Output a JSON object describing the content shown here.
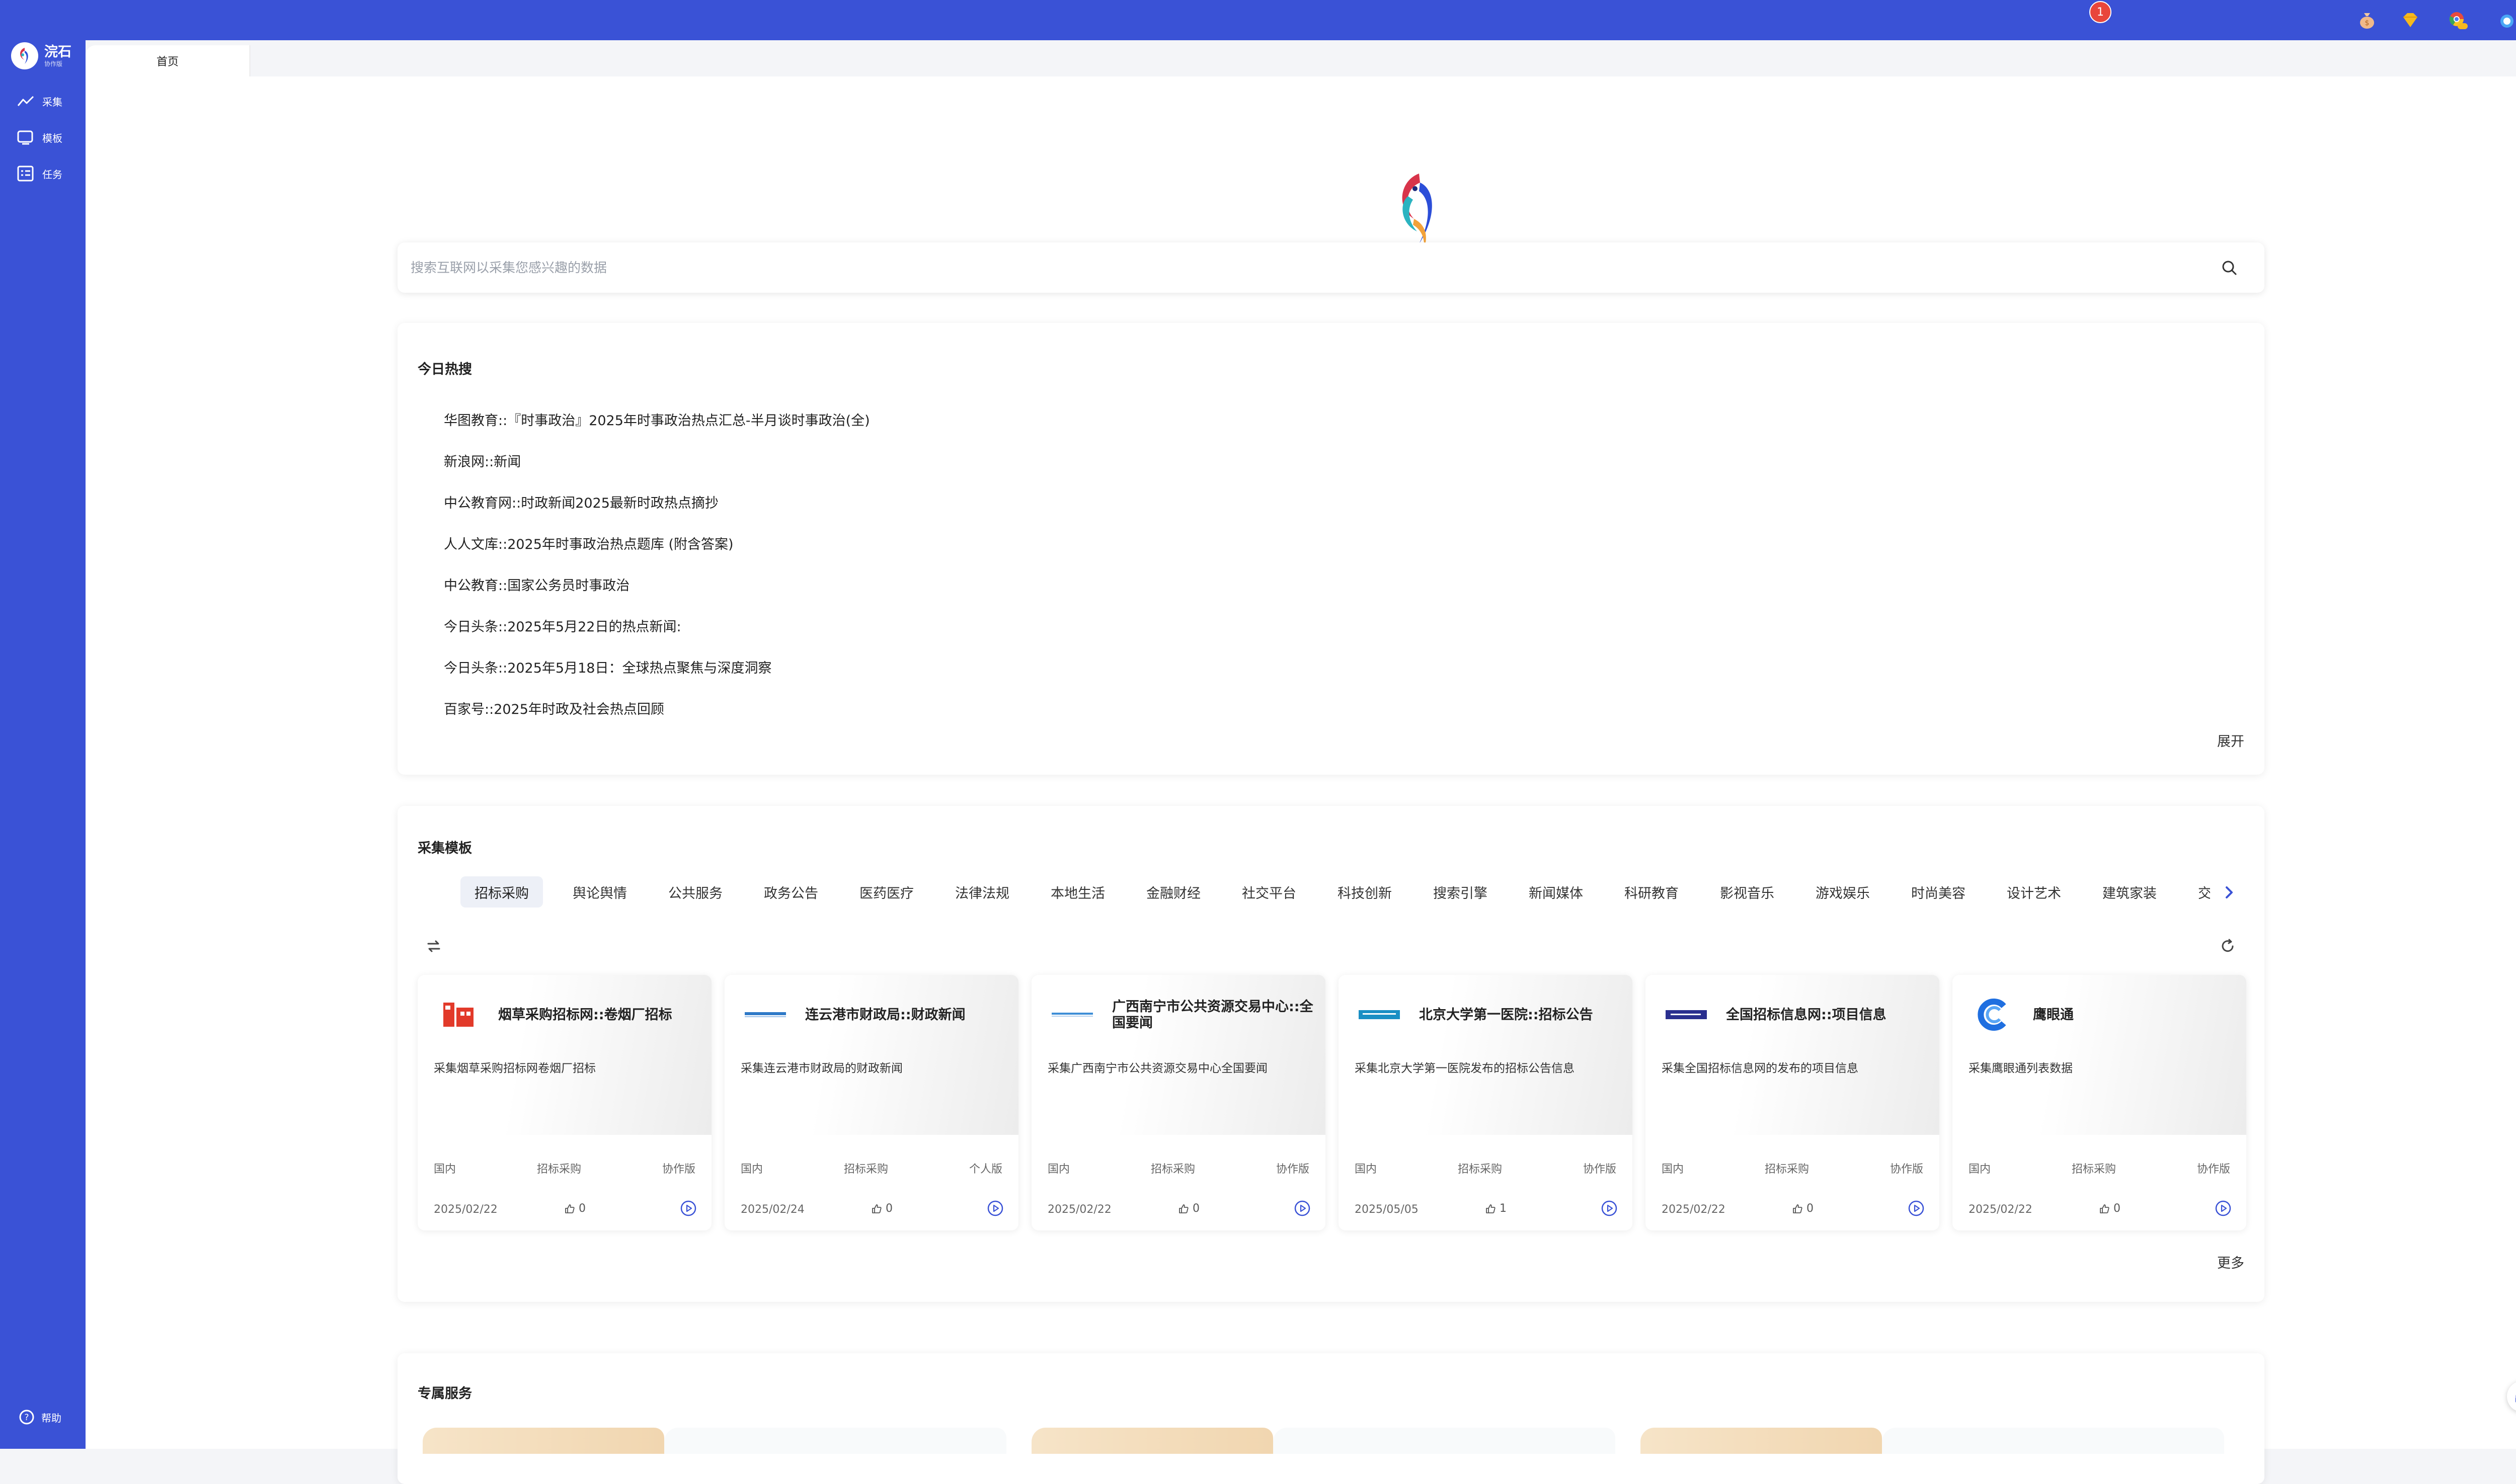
{
  "app": {
    "name": "浣石",
    "subtitle": "协作版"
  },
  "sidebar": {
    "items": [
      {
        "label": "采集",
        "icon": "trend-chart-icon"
      },
      {
        "label": "模板",
        "icon": "template-icon"
      },
      {
        "label": "任务",
        "icon": "task-list-icon"
      }
    ],
    "help_label": "帮助"
  },
  "topbar": {
    "icons": [
      "money-bag-icon",
      "diamond-icon",
      "chrome-beta-icon",
      "notification-icon",
      "user-icon"
    ],
    "notification_count": "1"
  },
  "tabs": [
    {
      "label": "首页"
    }
  ],
  "search": {
    "placeholder": "搜索互联网以采集您感兴趣的数据"
  },
  "hot": {
    "title": "今日热搜",
    "items": [
      "华图教育::『时事政治』2025年时事政治热点汇总-半月谈时事政治(全)",
      "新浪网::新闻",
      "中公教育网::时政新闻2025最新时政热点摘抄",
      "人人文库::2025年时事政治热点题库 (附含答案)",
      "中公教育::国家公务员时事政治",
      "今日头条::2025年5月22日的热点新闻:",
      "今日头条::2025年5月18日：全球热点聚焦与深度洞察",
      "百家号::2025年时政及社会热点回顾"
    ],
    "expand_label": "展开"
  },
  "templates": {
    "title": "采集模板",
    "categories": [
      "招标采购",
      "舆论舆情",
      "公共服务",
      "政务公告",
      "医药医疗",
      "法律法规",
      "本地生活",
      "金融财经",
      "社交平台",
      "科技创新",
      "搜索引擎",
      "新闻媒体",
      "科研教育",
      "影视音乐",
      "游戏娱乐",
      "时尚美容",
      "设计艺术",
      "建筑家装",
      "交通"
    ],
    "active_category": "招标采购",
    "cards": [
      {
        "title": "烟草采购招标网::卷烟厂招标",
        "desc": "采集烟草采购招标网卷烟厂招标",
        "region": "国内",
        "category": "招标采购",
        "edition": "协作版",
        "date": "2025/02/22",
        "likes": "0"
      },
      {
        "title": "连云港市财政局::财政新闻",
        "desc": "采集连云港市财政局的财政新闻",
        "region": "国内",
        "category": "招标采购",
        "edition": "个人版",
        "date": "2025/02/24",
        "likes": "0"
      },
      {
        "title": "广西南宁市公共资源交易中心::全国要闻",
        "desc": "采集广西南宁市公共资源交易中心全国要闻",
        "region": "国内",
        "category": "招标采购",
        "edition": "协作版",
        "date": "2025/02/22",
        "likes": "0"
      },
      {
        "title": "北京大学第一医院::招标公告",
        "desc": "采集北京大学第一医院发布的招标公告信息",
        "region": "国内",
        "category": "招标采购",
        "edition": "协作版",
        "date": "2025/05/05",
        "likes": "1"
      },
      {
        "title": "全国招标信息网::项目信息",
        "desc": "采集全国招标信息网的发布的项目信息",
        "region": "国内",
        "category": "招标采购",
        "edition": "协作版",
        "date": "2025/02/22",
        "likes": "0"
      },
      {
        "title": "鹰眼通",
        "desc": "采集鹰眼通列表数据",
        "region": "国内",
        "category": "招标采购",
        "edition": "协作版",
        "date": "2025/02/22",
        "likes": "0"
      }
    ],
    "more_label": "更多"
  },
  "services": {
    "title": "专属服务"
  },
  "colors": {
    "brand": "#3a52d6",
    "badge": "#e8463c"
  }
}
